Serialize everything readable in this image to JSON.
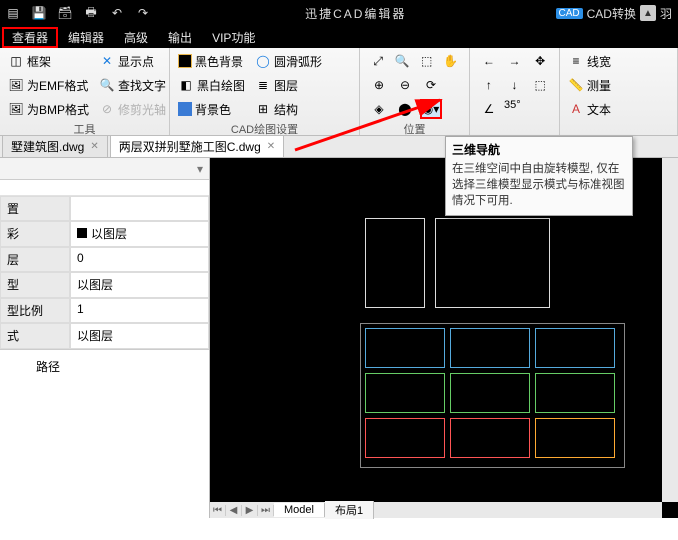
{
  "app": {
    "title": "迅捷CAD编辑器"
  },
  "titlebar_right": {
    "convert": "CAD转换",
    "user": "羽"
  },
  "menu": {
    "viewer": "查看器",
    "editor": "编辑器",
    "advanced": "高级",
    "output": "输出",
    "vip": "VIP功能"
  },
  "ribbon": {
    "group1": {
      "frame": "框架",
      "emf": "为EMF格式",
      "bmp": "为BMP格式",
      "label": "工具"
    },
    "group2": {
      "show_pts": "显示点",
      "find_text": "查找文字",
      "trim_aura": "修剪光轴"
    },
    "group3": {
      "black_bg": "黑色背景",
      "smooth_arc": "圆滑弧形",
      "bw_draw": "黑白绘图",
      "layers": "图层",
      "bg_color": "背景色",
      "structure": "结构",
      "label": "CAD绘图设置"
    },
    "group4": {
      "label": "35°"
    },
    "group5": {
      "label": "位置"
    },
    "group6": {
      "line_w": "线宽",
      "measure": "测量",
      "text": "文本"
    }
  },
  "tabs": {
    "t1": "墅建筑图.dwg",
    "t2": "两层双拼别墅施工图C.dwg"
  },
  "sidebar": {
    "rows": [
      {
        "k": "置",
        "v": ""
      },
      {
        "k": "彩",
        "v": "以图层",
        "sw": true
      },
      {
        "k": "层",
        "v": "0"
      },
      {
        "k": "型",
        "v": "以图层"
      },
      {
        "k": "型比例",
        "v": "1"
      },
      {
        "k": "式",
        "v": "以图层"
      }
    ],
    "path_label": "路径"
  },
  "tooltip": {
    "title": "三维导航",
    "body": "在三维空间中自由旋转模型, 仅在选择三维模型显示模式与标准视图情况下可用."
  },
  "sheets": {
    "model": "Model",
    "layout": "布局1"
  }
}
